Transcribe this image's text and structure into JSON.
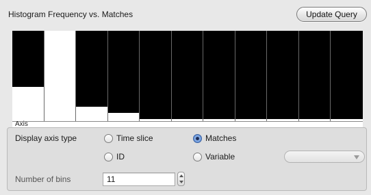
{
  "header": {
    "title": "Histogram  Frequency vs. Matches",
    "update_button": "Update Query"
  },
  "chart_data": {
    "type": "bar",
    "values": [
      0.38,
      1.0,
      0.16,
      0.09,
      0.02,
      0.02,
      0.02,
      0.02,
      0.02,
      0.02,
      0.02
    ],
    "xlabel": "Axis",
    "colors": {
      "background": "#000000",
      "bar": "#ffffff"
    }
  },
  "controls": {
    "display_axis_label": "Display axis type",
    "options": [
      {
        "label": "Time slice",
        "selected": false
      },
      {
        "label": "Matches",
        "selected": true
      },
      {
        "label": "ID",
        "selected": false
      },
      {
        "label": "Variable",
        "selected": false
      }
    ],
    "variable_select_value": "",
    "bins_label": "Number of bins",
    "bins_value": "11"
  }
}
